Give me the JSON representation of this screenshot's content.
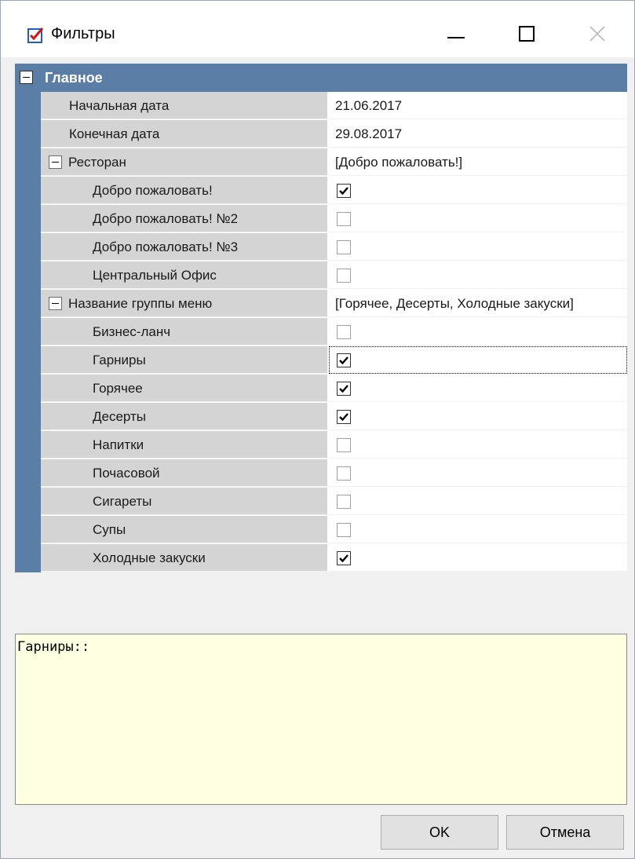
{
  "window": {
    "title": "Фильтры",
    "icon": "checkbox-window-icon",
    "controls": [
      "minimize-icon",
      "maximize-icon",
      "close-icon"
    ]
  },
  "grid": {
    "category": "Главное",
    "rows": [
      {
        "name": "Начальная дата",
        "value": "21.06.2017"
      },
      {
        "name": "Конечная дата",
        "value": "29.08.2017"
      },
      {
        "name": "Ресторан",
        "value": "[Добро пожаловать!]"
      },
      {
        "name": "Добро пожаловать!",
        "checked": true
      },
      {
        "name": "Добро пожаловать! №2",
        "checked": false
      },
      {
        "name": "Добро пожаловать! №3",
        "checked": false
      },
      {
        "name": "Центральный Офис",
        "checked": false
      },
      {
        "name": "Название группы меню",
        "value": "[Горячее, Десерты, Холодные закуски]"
      },
      {
        "name": "Бизнес-ланч",
        "checked": false
      },
      {
        "name": "Гарниры",
        "checked": true
      },
      {
        "name": "Горячее",
        "checked": true
      },
      {
        "name": "Десерты",
        "checked": true
      },
      {
        "name": "Напитки",
        "checked": false
      },
      {
        "name": "Почасовой",
        "checked": false
      },
      {
        "name": "Сигареты",
        "checked": false
      },
      {
        "name": "Супы",
        "checked": false
      },
      {
        "name": "Холодные закуски",
        "checked": true
      }
    ]
  },
  "description": {
    "text": "Гарниры::"
  },
  "buttons": {
    "ok": "OK",
    "cancel": "Отмена"
  },
  "colors": {
    "category_bar": "#5b7ea6",
    "name_cell": "#d4d4d4",
    "description_bg": "#ffffe1"
  }
}
